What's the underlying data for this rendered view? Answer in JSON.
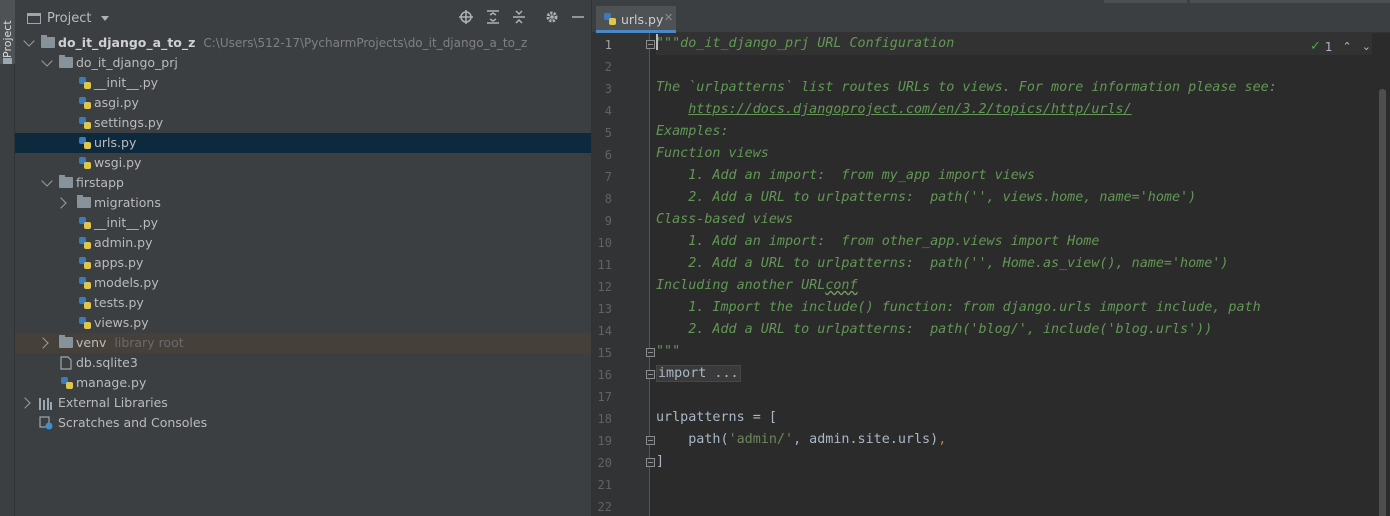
{
  "project_panel": {
    "title": "Project",
    "tree": [
      {
        "label": "do_it_django_a_to_z",
        "path": "C:\\Users\\512-17\\PycharmProjects\\do_it_django_a_to_z"
      },
      {
        "label": "do_it_django_prj"
      },
      {
        "label": "__init__.py"
      },
      {
        "label": "asgi.py"
      },
      {
        "label": "settings.py"
      },
      {
        "label": "urls.py"
      },
      {
        "label": "wsgi.py"
      },
      {
        "label": "firstapp"
      },
      {
        "label": "migrations"
      },
      {
        "label": "__init__.py"
      },
      {
        "label": "admin.py"
      },
      {
        "label": "apps.py"
      },
      {
        "label": "models.py"
      },
      {
        "label": "tests.py"
      },
      {
        "label": "views.py"
      },
      {
        "label": "venv",
        "hint": "library root"
      },
      {
        "label": "db.sqlite3"
      },
      {
        "label": "manage.py"
      },
      {
        "label": "External Libraries"
      },
      {
        "label": "Scratches and Consoles"
      }
    ]
  },
  "tool_strip": {
    "project_tab": "Project"
  },
  "editor": {
    "tab_label": "urls.py",
    "inspection_count": "1",
    "line_numbers": [
      "1",
      "2",
      "3",
      "4",
      "5",
      "6",
      "7",
      "8",
      "9",
      "10",
      "11",
      "12",
      "13",
      "14",
      "15",
      "16",
      "17",
      "18",
      "19",
      "20",
      "21",
      "22"
    ],
    "lines": {
      "l1": "\"\"\"do_it_django_prj URL Configuration",
      "l3": "The `urlpatterns` list routes URLs to views. For more information please see:",
      "l4_indent": "    ",
      "l4_url": "https://docs.djangoproject.com/en/3.2/topics/http/urls/",
      "l5": "Examples:",
      "l6": "Function views",
      "l7": "    1. Add an import:  from my_app import views",
      "l8": "    2. Add a URL to urlpatterns:  path('', views.home, name='home')",
      "l9": "Class-based views",
      "l10": "    1. Add an import:  from other_app.views import Home",
      "l11": "    2. Add a URL to urlpatterns:  path('', Home.as_view(), name='home')",
      "l12_a": "Including another URL",
      "l12_b": "conf",
      "l13": "    1. Import the include() function: from django.urls import include, path",
      "l14": "    2. Add a URL to urlpatterns:  path('blog/', include('blog.urls'))",
      "l15": "\"\"\"",
      "l16": "import ...",
      "l19": "urlpatterns = [",
      "l20_a": "    path(",
      "l20_b": "'admin/'",
      "l20_c": ", admin.site.urls)",
      "l20_d": ",",
      "l21": "]"
    }
  },
  "colors": {
    "panel_bg": "#3c3f41",
    "editor_bg": "#2b2b2b",
    "selection": "#0d293e",
    "docstring": "#629755",
    "string": "#6a8759",
    "keyword": "#cc7832"
  }
}
